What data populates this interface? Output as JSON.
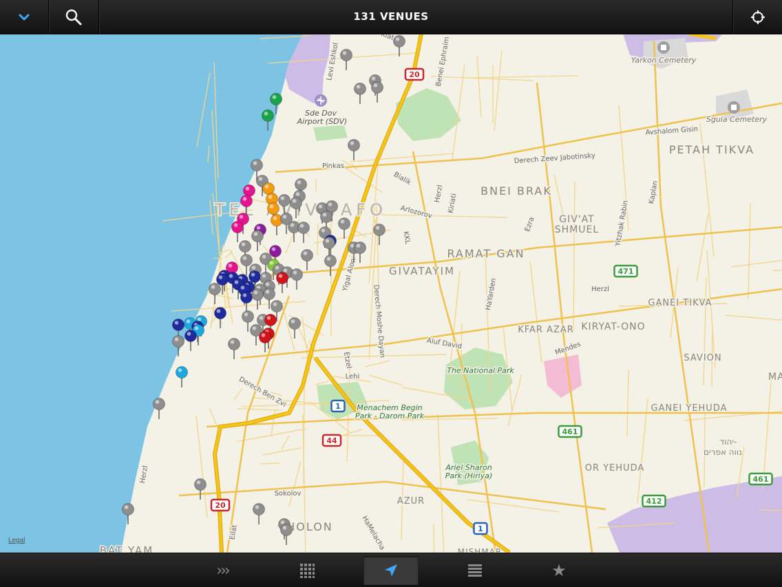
{
  "header": {
    "title": "131 VENUES",
    "collapse_icon": "chevron-down-icon",
    "search_icon": "search-icon",
    "locate_icon": "crosshair-icon"
  },
  "map": {
    "legal_link": "Legal",
    "labels": {
      "tel_aviv": "TEL AVIV-YAFO",
      "bnei_brak": "BNEI BRAK",
      "petah_tikva": "PETAH TIKVA",
      "ramat_gan": "RAMAT GAN",
      "givatayim": "GIVATAYIM",
      "givat_shmuel_1": "GIV'AT",
      "givat_shmuel_2": "SHMUEL",
      "ganei_tikva": "GANEI TIKVA",
      "kfar_azar": "KFAR AZAR",
      "kiryat_ono": "KIRYAT-ONO",
      "savion": "SAVION",
      "ganei_yehuda": "GANEI YEHUDA",
      "or_yehuda": "OR YEHUDA",
      "holon": "HOLON",
      "azur": "AZUR",
      "bat_yam": "BAT YAM",
      "mishmar": "MISHMAR",
      "mags": "MAGS",
      "hebrew_1": "יהוד-",
      "hebrew_2": "נווה אפרים",
      "yarkon_cemetery": "Yarkon Cemetery",
      "sgula_cemetery": "Sgula Cemetery",
      "sde_dov_1": "Sde Dov",
      "sde_dov_2": "Airport (SDV)",
      "national_park": "The National Park",
      "menachem_begin_1": "Menachem Begin",
      "menachem_begin_2": "Park - Darom Park",
      "ariel_sharon_1": "Ariel Sharon",
      "ariel_sharon_2": "Park (Hiriya)",
      "avshalom_gisin": "Avshalom Gisin",
      "jabotinsky": "Derech Zeev Jabotinsky",
      "pinkas": "Pinkas",
      "bialik": "Bialik",
      "arlozorov": "Arlozorov",
      "herzl_1": "Herzl",
      "herzl_2": "Herzl",
      "herzl_3": "Herzl",
      "kkl": "KKL",
      "yigal_alon": "Yigal Alon",
      "moshe_dayan": "Derech Moshe Dayan",
      "aluf_david": "Aluf David",
      "etzel": "Etzel",
      "lehi": "Lehi",
      "ben_zvi": "Derech Ben Zvi",
      "sokolov": "Sokolov",
      "hamelacha": "HaMelacha",
      "eilat": "Eilat",
      "hayarden": "HaYarden",
      "mendes": "Mendes",
      "yitzhak_rabin": "Yitzhak Rabin",
      "kaplan": "Kaplan",
      "ezra": "Ezra",
      "levi_eshkol": "Levi Eshkol",
      "benei_efraim": "Benei Ephraim",
      "klatzkin": "Klat",
      "kiryati": "Kiriati"
    },
    "route_shields": [
      {
        "num": "20",
        "type": "red"
      },
      {
        "num": "20",
        "type": "red"
      },
      {
        "num": "44",
        "type": "red"
      },
      {
        "num": "1",
        "type": "blue"
      },
      {
        "num": "1",
        "type": "blue"
      },
      {
        "num": "471",
        "type": "green"
      },
      {
        "num": "461",
        "type": "green"
      },
      {
        "num": "461",
        "type": "green"
      },
      {
        "num": "412",
        "type": "green"
      }
    ],
    "pin_colors": {
      "gray": "#8e8e8e",
      "blue": "#1f2a9c",
      "red": "#d0141a",
      "magenta": "#e4138e",
      "orange": "#f39a10",
      "green": "#1aa34a",
      "light_green": "#86c540",
      "purple": "#8a1c9b",
      "cyan": "#1fa8e0"
    }
  },
  "tabbar": {
    "tabs": [
      {
        "name": "tab-more",
        "icon": "chevrons-right-icon",
        "glyph": "›››",
        "active": false
      },
      {
        "name": "tab-grid",
        "icon": "grid-icon",
        "glyph": "▦",
        "active": false
      },
      {
        "name": "tab-nearby",
        "icon": "navigation-arrow-icon",
        "glyph": "",
        "active": true
      },
      {
        "name": "tab-list",
        "icon": "list-icon",
        "glyph": "☰",
        "active": false
      },
      {
        "name": "tab-favorites",
        "icon": "star-icon",
        "glyph": "★",
        "active": false
      }
    ]
  }
}
